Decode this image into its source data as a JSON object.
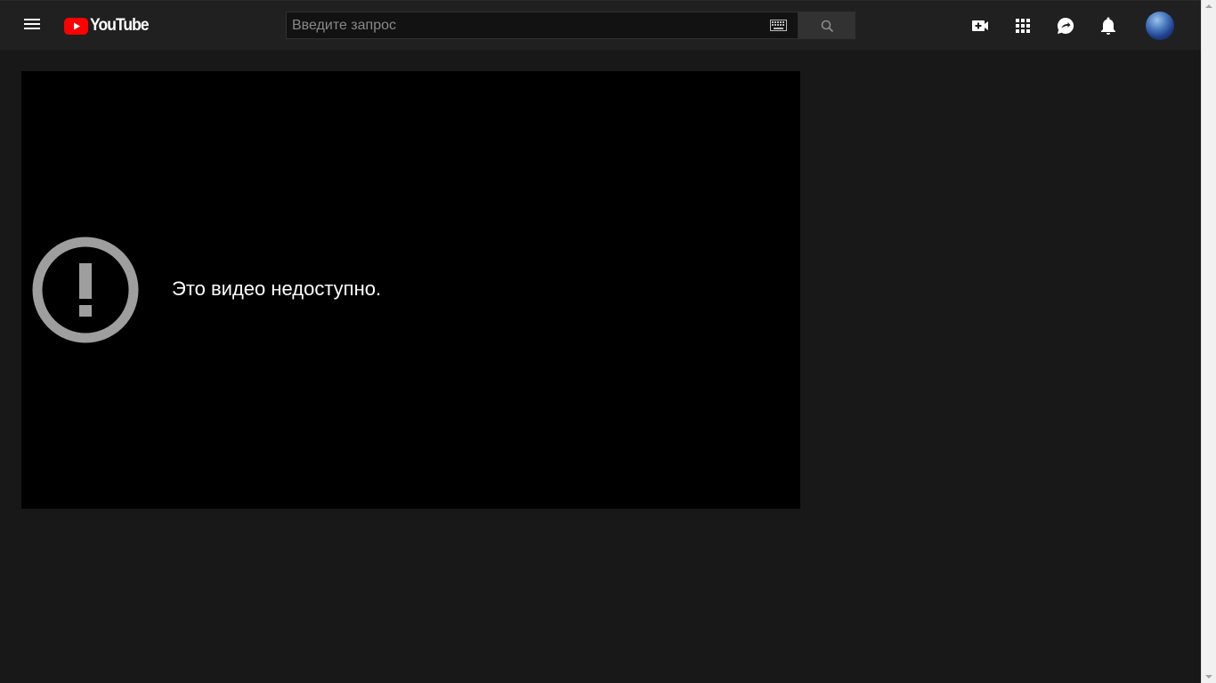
{
  "header": {
    "logo_text": "YouTube",
    "search": {
      "placeholder": "Введите запрос",
      "value": ""
    }
  },
  "player": {
    "error_message": "Это видео недоступно."
  },
  "icons": {
    "menu": "menu-icon",
    "logo": "youtube-logo-icon",
    "keyboard": "keyboard-icon",
    "search": "search-icon",
    "create": "create-video-icon",
    "apps": "apps-grid-icon",
    "messages": "messages-icon",
    "notifications": "bell-icon",
    "error": "error-exclamation-icon"
  },
  "colors": {
    "page_background": "#181818",
    "masthead_background": "#202020",
    "player_background": "#000000",
    "brand_red": "#ff0000",
    "error_icon": "#9e9e9e"
  }
}
